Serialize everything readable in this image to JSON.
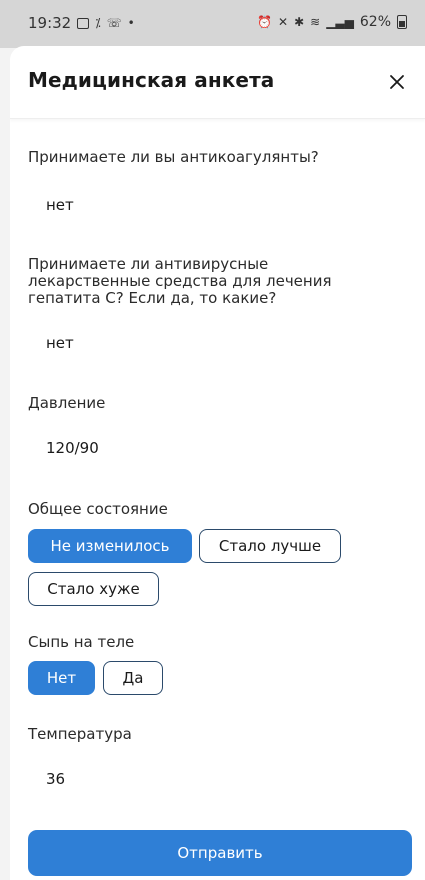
{
  "status_bar": {
    "time": "19:32",
    "battery": "62%"
  },
  "header": {
    "title": "Медицинская анкета",
    "close_icon": "close-icon"
  },
  "questions": [
    {
      "label": "Принимаете ли вы антикоагулянты?",
      "answer": "нет"
    },
    {
      "label_lines": [
        "Принимаете ли антивирусные",
        "лекарственные средства для лечения",
        "гепатита С? Если да, то какие?"
      ],
      "answer": "нет"
    },
    {
      "label": "Давление",
      "answer": "120/90"
    }
  ],
  "general_state": {
    "label": "Общее состояние",
    "options": [
      "Не изменилось",
      "Стало лучше",
      "Стало хуже"
    ],
    "selected": "Не изменилось"
  },
  "rash": {
    "label": "Сыпь на теле",
    "options": [
      "Нет",
      "Да"
    ],
    "selected": "Нет"
  },
  "temperature": {
    "label": "Температура",
    "answer": "36"
  },
  "submit_label": "Отправить",
  "colors": {
    "accent": "#2f7fd6",
    "outline": "#2b4a6b"
  }
}
